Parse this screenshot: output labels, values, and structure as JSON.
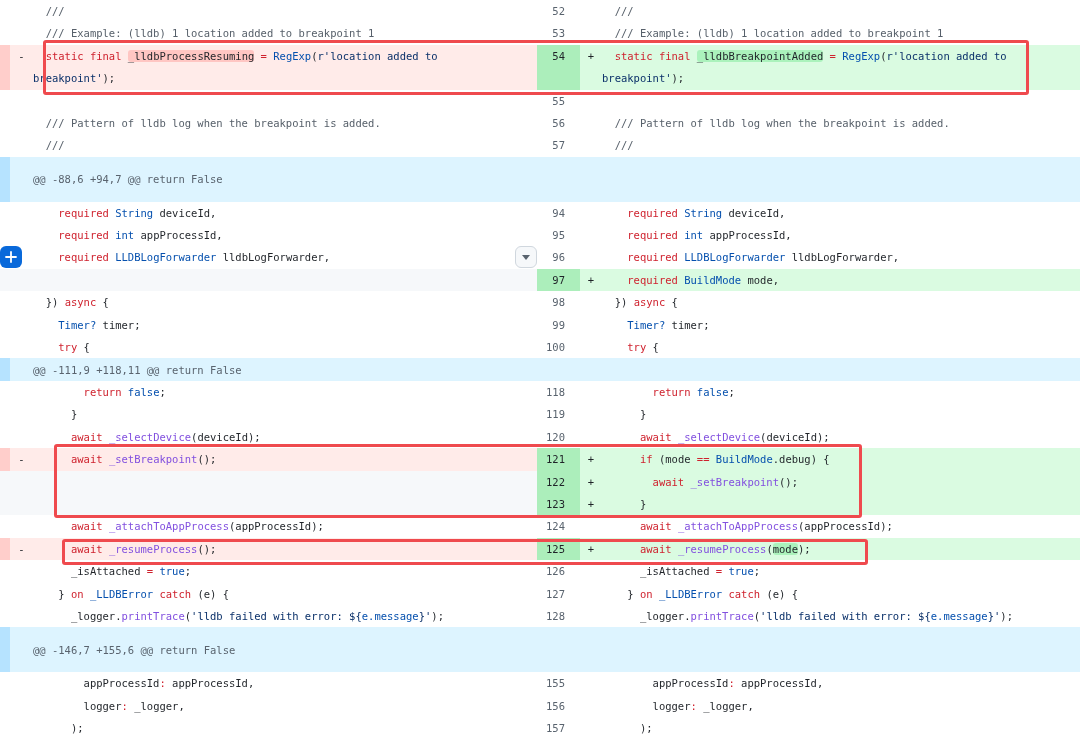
{
  "diff": {
    "rows": [
      {
        "kind": "line",
        "hovered": false,
        "left": {
          "kind": "context",
          "code": [
            {
              "text": "  ///",
              "kind": "comment"
            }
          ]
        },
        "right": {
          "kind": "context",
          "number": "52",
          "code": [
            {
              "text": "  ///",
              "kind": "comment"
            }
          ]
        }
      },
      {
        "kind": "line",
        "hovered": false,
        "left": {
          "kind": "context",
          "code": [
            {
              "text": "  /// Example: (lldb) 1 location added to breakpoint 1",
              "kind": "comment"
            }
          ]
        },
        "right": {
          "kind": "context",
          "number": "53",
          "code": [
            {
              "text": "  /// Example: (lldb) 1 location added to breakpoint 1",
              "kind": "comment"
            }
          ]
        }
      },
      {
        "kind": "line",
        "hovered": false,
        "left": {
          "kind": "deleted",
          "sign": "-",
          "code": [
            {
              "text": "  static final ",
              "kind": "keyword"
            },
            {
              "text": "_lldbProcessResuming",
              "kind": "changed"
            },
            {
              "text": " = ",
              "kind": "keyword"
            },
            {
              "text": "RegExp",
              "kind": "type"
            },
            {
              "text": "(",
              "kind": "plain"
            },
            {
              "text": "r'location added to breakpoint'",
              "kind": "string"
            },
            {
              "text": ");",
              "kind": "plain"
            }
          ]
        },
        "right": {
          "kind": "added",
          "number": "54",
          "sign": "+",
          "code": [
            {
              "text": "  static final ",
              "kind": "keyword"
            },
            {
              "text": "_lldbBreakpointAdded",
              "kind": "changed"
            },
            {
              "text": " = ",
              "kind": "keyword"
            },
            {
              "text": "RegExp",
              "kind": "type"
            },
            {
              "text": "(",
              "kind": "plain"
            },
            {
              "text": "r'location added to breakpoint'",
              "kind": "string"
            },
            {
              "text": ");",
              "kind": "plain"
            }
          ]
        }
      },
      {
        "kind": "line",
        "hovered": false,
        "left": {
          "kind": "context"
        },
        "right": {
          "kind": "context",
          "number": "55"
        }
      },
      {
        "kind": "line",
        "hovered": false,
        "left": {
          "kind": "context",
          "code": [
            {
              "text": "  /// Pattern of lldb log when the breakpoint is added.",
              "kind": "comment"
            }
          ]
        },
        "right": {
          "kind": "context",
          "number": "56",
          "code": [
            {
              "text": "  /// Pattern of lldb log when the breakpoint is added.",
              "kind": "comment"
            }
          ]
        }
      },
      {
        "kind": "line",
        "hovered": false,
        "left": {
          "kind": "context",
          "code": [
            {
              "text": "  ///",
              "kind": "comment"
            }
          ]
        },
        "right": {
          "kind": "context",
          "number": "57",
          "code": [
            {
              "text": "  ///",
              "kind": "comment"
            }
          ]
        }
      },
      {
        "kind": "hunk",
        "tall": true,
        "header": "@@ -88,6 +94,7 @@ return False"
      },
      {
        "kind": "line",
        "hovered": false,
        "left": {
          "kind": "context",
          "code": [
            {
              "text": "    required ",
              "kind": "keyword"
            },
            {
              "text": "String",
              "kind": "type"
            },
            {
              "text": " deviceId,",
              "kind": "plain"
            }
          ]
        },
        "right": {
          "kind": "context",
          "number": "94",
          "code": [
            {
              "text": "    required ",
              "kind": "keyword"
            },
            {
              "text": "String",
              "kind": "type"
            },
            {
              "text": " deviceId,",
              "kind": "plain"
            }
          ]
        }
      },
      {
        "kind": "line",
        "hovered": false,
        "left": {
          "kind": "context",
          "code": [
            {
              "text": "    required ",
              "kind": "keyword"
            },
            {
              "text": "int",
              "kind": "type"
            },
            {
              "text": " appProcessId,",
              "kind": "plain"
            }
          ]
        },
        "right": {
          "kind": "context",
          "number": "95",
          "code": [
            {
              "text": "    required ",
              "kind": "keyword"
            },
            {
              "text": "int",
              "kind": "type"
            },
            {
              "text": " appProcessId,",
              "kind": "plain"
            }
          ]
        }
      },
      {
        "kind": "line",
        "hovered": true,
        "left": {
          "kind": "context",
          "code": [
            {
              "text": "    required ",
              "kind": "keyword"
            },
            {
              "text": "LLDBLogForwarder",
              "kind": "type"
            },
            {
              "text": " lldbLogForwarder,",
              "kind": "plain"
            }
          ]
        },
        "right": {
          "kind": "context",
          "number": "96",
          "code": [
            {
              "text": "    required ",
              "kind": "keyword"
            },
            {
              "text": "LLDBLogForwarder",
              "kind": "type"
            },
            {
              "text": " lldbLogForwarder,",
              "kind": "plain"
            }
          ]
        }
      },
      {
        "kind": "line",
        "hovered": false,
        "left": {
          "kind": "empty"
        },
        "right": {
          "kind": "added",
          "number": "97",
          "sign": "+",
          "code": [
            {
              "text": "    required ",
              "kind": "keyword"
            },
            {
              "text": "BuildMode",
              "kind": "type"
            },
            {
              "text": " mode,",
              "kind": "plain"
            }
          ]
        }
      },
      {
        "kind": "line",
        "hovered": false,
        "left": {
          "kind": "context",
          "code": [
            {
              "text": "  }) ",
              "kind": "plain"
            },
            {
              "text": "async",
              "kind": "keyword"
            },
            {
              "text": " {",
              "kind": "plain"
            }
          ]
        },
        "right": {
          "kind": "context",
          "number": "98",
          "code": [
            {
              "text": "  }) ",
              "kind": "plain"
            },
            {
              "text": "async",
              "kind": "keyword"
            },
            {
              "text": " {",
              "kind": "plain"
            }
          ]
        }
      },
      {
        "kind": "line",
        "hovered": false,
        "left": {
          "kind": "context",
          "code": [
            {
              "text": "    Timer?",
              "kind": "type"
            },
            {
              "text": " timer;",
              "kind": "plain"
            }
          ]
        },
        "right": {
          "kind": "context",
          "number": "99",
          "code": [
            {
              "text": "    Timer?",
              "kind": "type"
            },
            {
              "text": " timer;",
              "kind": "plain"
            }
          ]
        }
      },
      {
        "kind": "line",
        "hovered": false,
        "left": {
          "kind": "context",
          "code": [
            {
              "text": "    try",
              "kind": "keyword"
            },
            {
              "text": " {",
              "kind": "plain"
            }
          ]
        },
        "right": {
          "kind": "context",
          "number": "100",
          "code": [
            {
              "text": "    try",
              "kind": "keyword"
            },
            {
              "text": " {",
              "kind": "plain"
            }
          ]
        }
      },
      {
        "kind": "hunk",
        "tall": false,
        "header": "@@ -111,9 +118,11 @@ return False"
      },
      {
        "kind": "line",
        "hovered": false,
        "left": {
          "kind": "context",
          "code": [
            {
              "text": "        return ",
              "kind": "keyword"
            },
            {
              "text": "false",
              "kind": "constant"
            },
            {
              "text": ";",
              "kind": "plain"
            }
          ]
        },
        "right": {
          "kind": "context",
          "number": "118",
          "code": [
            {
              "text": "        return ",
              "kind": "keyword"
            },
            {
              "text": "false",
              "kind": "constant"
            },
            {
              "text": ";",
              "kind": "plain"
            }
          ]
        }
      },
      {
        "kind": "line",
        "hovered": false,
        "left": {
          "kind": "context",
          "code": [
            {
              "text": "      }",
              "kind": "plain"
            }
          ]
        },
        "right": {
          "kind": "context",
          "number": "119",
          "code": [
            {
              "text": "      }",
              "kind": "plain"
            }
          ]
        }
      },
      {
        "kind": "line",
        "hovered": false,
        "left": {
          "kind": "context",
          "code": [
            {
              "text": "      await ",
              "kind": "keyword"
            },
            {
              "text": "_selectDevice",
              "kind": "function"
            },
            {
              "text": "(deviceId);",
              "kind": "plain"
            }
          ]
        },
        "right": {
          "kind": "context",
          "number": "120",
          "code": [
            {
              "text": "      await ",
              "kind": "keyword"
            },
            {
              "text": "_selectDevice",
              "kind": "function"
            },
            {
              "text": "(deviceId);",
              "kind": "plain"
            }
          ]
        }
      },
      {
        "kind": "line",
        "hovered": false,
        "left": {
          "kind": "deleted",
          "sign": "-",
          "code": [
            {
              "text": "      await ",
              "kind": "keyword"
            },
            {
              "text": "_setBreakpoint",
              "kind": "function"
            },
            {
              "text": "();",
              "kind": "plain"
            }
          ]
        },
        "right": {
          "kind": "added",
          "number": "121",
          "sign": "+",
          "code": [
            {
              "text": "      if",
              "kind": "keyword"
            },
            {
              "text": " (mode ",
              "kind": "plain"
            },
            {
              "text": "== ",
              "kind": "keyword"
            },
            {
              "text": "BuildMode",
              "kind": "type"
            },
            {
              "text": ".debug) {",
              "kind": "plain"
            }
          ]
        }
      },
      {
        "kind": "line",
        "hovered": false,
        "left": {
          "kind": "empty"
        },
        "right": {
          "kind": "added",
          "number": "122",
          "sign": "+",
          "code": [
            {
              "text": "        await ",
              "kind": "keyword"
            },
            {
              "text": "_setBreakpoint",
              "kind": "function"
            },
            {
              "text": "();",
              "kind": "plain"
            }
          ]
        }
      },
      {
        "kind": "line",
        "hovered": false,
        "left": {
          "kind": "empty"
        },
        "right": {
          "kind": "added",
          "number": "123",
          "sign": "+",
          "code": [
            {
              "text": "      }",
              "kind": "plain"
            }
          ]
        }
      },
      {
        "kind": "line",
        "hovered": false,
        "left": {
          "kind": "context",
          "code": [
            {
              "text": "      await ",
              "kind": "keyword"
            },
            {
              "text": "_attachToAppProcess",
              "kind": "function"
            },
            {
              "text": "(appProcessId);",
              "kind": "plain"
            }
          ]
        },
        "right": {
          "kind": "context",
          "number": "124",
          "code": [
            {
              "text": "      await ",
              "kind": "keyword"
            },
            {
              "text": "_attachToAppProcess",
              "kind": "function"
            },
            {
              "text": "(appProcessId);",
              "kind": "plain"
            }
          ]
        }
      },
      {
        "kind": "line",
        "hovered": false,
        "left": {
          "kind": "deleted",
          "sign": "-",
          "code": [
            {
              "text": "      await ",
              "kind": "keyword"
            },
            {
              "text": "_resumeProcess",
              "kind": "function"
            },
            {
              "text": "();",
              "kind": "plain"
            }
          ]
        },
        "right": {
          "kind": "added",
          "number": "125",
          "sign": "+",
          "code": [
            {
              "text": "      await ",
              "kind": "keyword"
            },
            {
              "text": "_resumeProcess",
              "kind": "function"
            },
            {
              "text": "(",
              "kind": "plain"
            },
            {
              "text": "mode",
              "kind": "changed"
            },
            {
              "text": ");",
              "kind": "plain"
            }
          ]
        }
      },
      {
        "kind": "line",
        "hovered": false,
        "left": {
          "kind": "context",
          "code": [
            {
              "text": "      _isAttached ",
              "kind": "plain"
            },
            {
              "text": "= ",
              "kind": "keyword"
            },
            {
              "text": "true",
              "kind": "constant"
            },
            {
              "text": ";",
              "kind": "plain"
            }
          ]
        },
        "right": {
          "kind": "context",
          "number": "126",
          "code": [
            {
              "text": "      _isAttached ",
              "kind": "plain"
            },
            {
              "text": "= ",
              "kind": "keyword"
            },
            {
              "text": "true",
              "kind": "constant"
            },
            {
              "text": ";",
              "kind": "plain"
            }
          ]
        }
      },
      {
        "kind": "line",
        "hovered": false,
        "left": {
          "kind": "context",
          "code": [
            {
              "text": "    } ",
              "kind": "plain"
            },
            {
              "text": "on ",
              "kind": "keyword"
            },
            {
              "text": "_LLDBError ",
              "kind": "type"
            },
            {
              "text": "catch",
              "kind": "keyword"
            },
            {
              "text": " (e) {",
              "kind": "plain"
            }
          ]
        },
        "right": {
          "kind": "context",
          "number": "127",
          "code": [
            {
              "text": "    } ",
              "kind": "plain"
            },
            {
              "text": "on ",
              "kind": "keyword"
            },
            {
              "text": "_LLDBError ",
              "kind": "type"
            },
            {
              "text": "catch",
              "kind": "keyword"
            },
            {
              "text": " (e) {",
              "kind": "plain"
            }
          ]
        }
      },
      {
        "kind": "line",
        "hovered": false,
        "left": {
          "kind": "context",
          "code": [
            {
              "text": "      _logger.",
              "kind": "plain"
            },
            {
              "text": "printTrace",
              "kind": "function"
            },
            {
              "text": "(",
              "kind": "plain"
            },
            {
              "text": "'lldb failed with error: ${",
              "kind": "string"
            },
            {
              "text": "e.message",
              "kind": "constant"
            },
            {
              "text": "}'",
              "kind": "string"
            },
            {
              "text": ");",
              "kind": "plain"
            }
          ]
        },
        "right": {
          "kind": "context",
          "number": "128",
          "code": [
            {
              "text": "      _logger.",
              "kind": "plain"
            },
            {
              "text": "printTrace",
              "kind": "function"
            },
            {
              "text": "(",
              "kind": "plain"
            },
            {
              "text": "'lldb failed with error: ${",
              "kind": "string"
            },
            {
              "text": "e.message",
              "kind": "constant"
            },
            {
              "text": "}'",
              "kind": "string"
            },
            {
              "text": ");",
              "kind": "plain"
            }
          ]
        }
      },
      {
        "kind": "hunk",
        "tall": true,
        "header": "@@ -146,7 +155,6 @@ return False"
      },
      {
        "kind": "line",
        "hovered": false,
        "left": {
          "kind": "context",
          "code": [
            {
              "text": "        appProcessId",
              "kind": "plain"
            },
            {
              "text": ":",
              "kind": "keyword"
            },
            {
              "text": " appProcessId,",
              "kind": "plain"
            }
          ]
        },
        "right": {
          "kind": "context",
          "number": "155",
          "code": [
            {
              "text": "        appProcessId",
              "kind": "plain"
            },
            {
              "text": ":",
              "kind": "keyword"
            },
            {
              "text": " appProcessId,",
              "kind": "plain"
            }
          ]
        }
      },
      {
        "kind": "line",
        "hovered": false,
        "left": {
          "kind": "context",
          "code": [
            {
              "text": "        logger",
              "kind": "plain"
            },
            {
              "text": ":",
              "kind": "keyword"
            },
            {
              "text": " _logger,",
              "kind": "plain"
            }
          ]
        },
        "right": {
          "kind": "context",
          "number": "156",
          "code": [
            {
              "text": "        logger",
              "kind": "plain"
            },
            {
              "text": ":",
              "kind": "keyword"
            },
            {
              "text": " _logger,",
              "kind": "plain"
            }
          ]
        }
      },
      {
        "kind": "line",
        "hovered": false,
        "left": {
          "kind": "context",
          "code": [
            {
              "text": "      );",
              "kind": "plain"
            }
          ]
        },
        "right": {
          "kind": "context",
          "number": "157",
          "code": [
            {
              "text": "      );",
              "kind": "plain"
            }
          ]
        }
      }
    ]
  }
}
